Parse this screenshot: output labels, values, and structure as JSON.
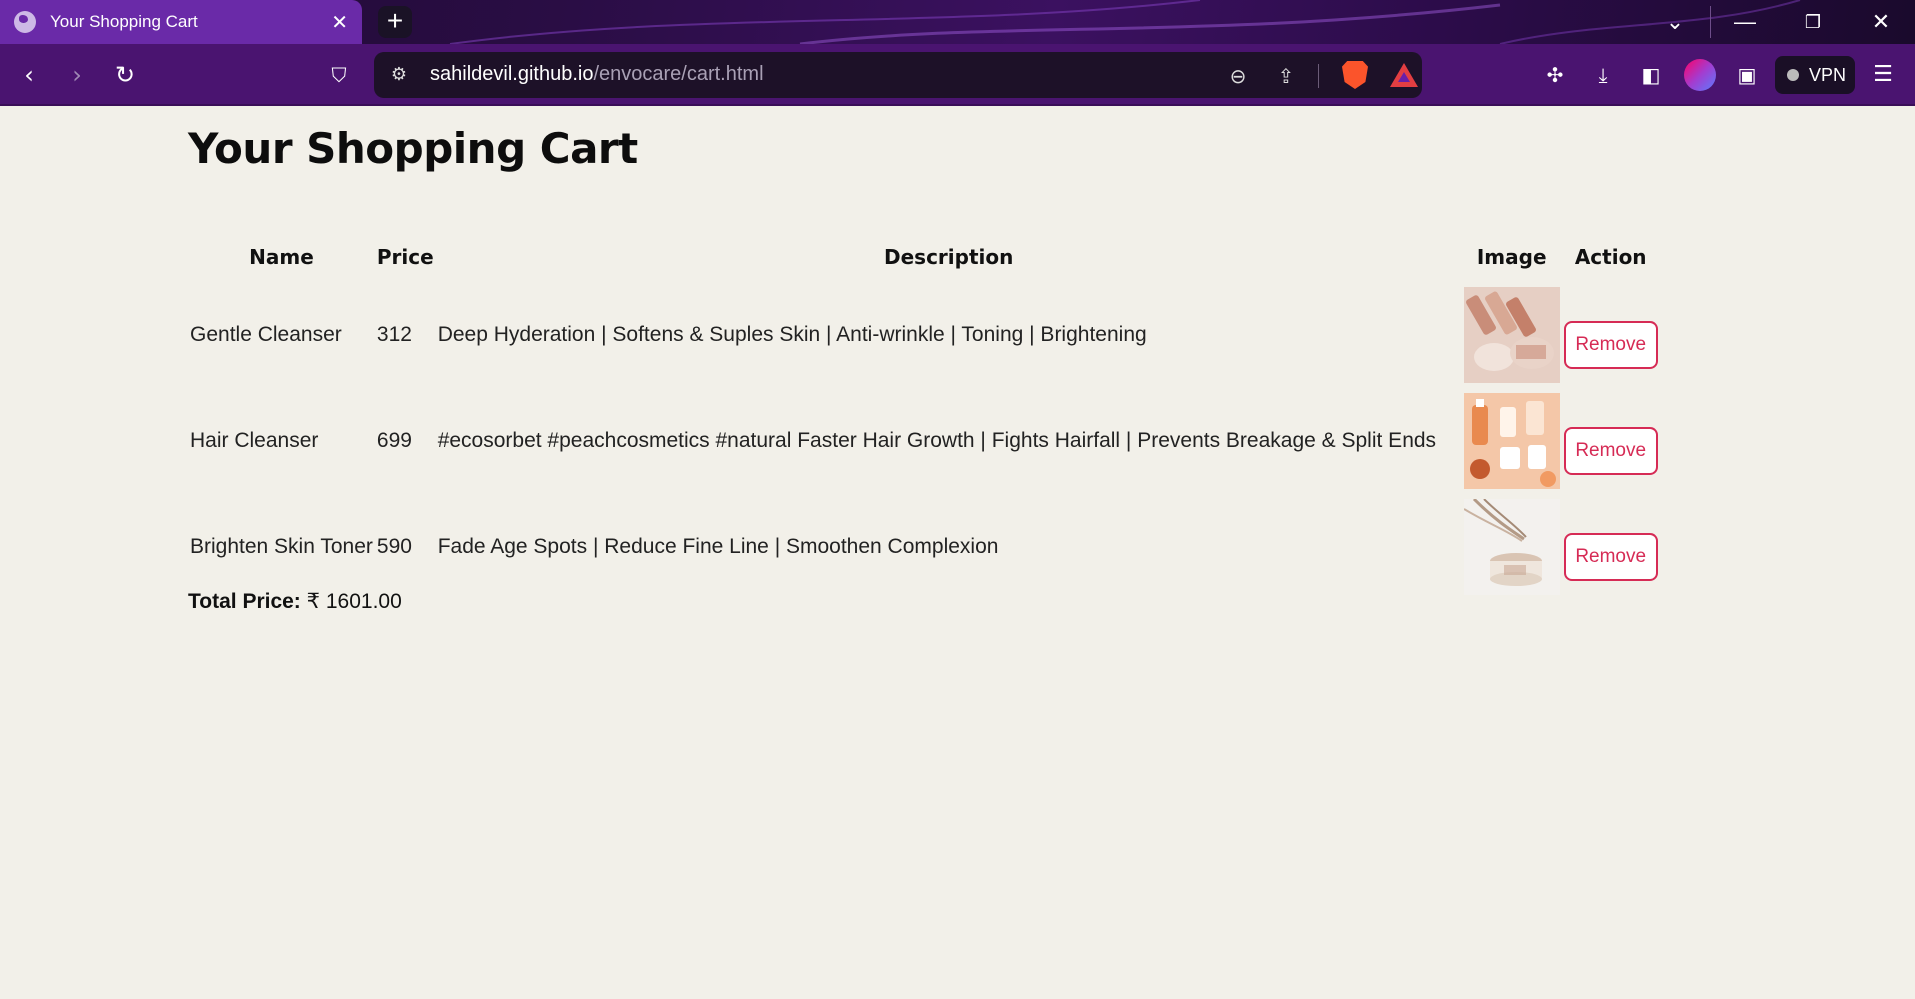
{
  "browser": {
    "tab_title": "Your Shopping Cart",
    "tab_close_icon": "close-icon",
    "new_tab_icon": "plus-icon",
    "url_host": "sahildevil.github.io",
    "url_path": "/envocare/cart.html",
    "vpn_label": "VPN",
    "accent_color": "#6a2aa8"
  },
  "page": {
    "heading": "Your Shopping Cart",
    "columns": {
      "name": "Name",
      "price": "Price",
      "description": "Description",
      "image": "Image",
      "action": "Action"
    },
    "items": [
      {
        "name": "Gentle Cleanser",
        "price": "312",
        "description": "Deep Hyderation | Softens & Suples Skin | Anti-wrinkle | Toning | Brightening",
        "action_label": "Remove"
      },
      {
        "name": "Hair Cleanser",
        "price": "699",
        "description": "#ecosorbet #peachcosmetics #natural Faster Hair Growth | Fights Hairfall | Prevents Breakage & Split Ends",
        "action_label": "Remove"
      },
      {
        "name": "Brighten Skin Toner",
        "price": "590",
        "description": "Fade Age Spots | Reduce Fine Line | Smoothen Complexion",
        "action_label": "Remove"
      }
    ],
    "total_label": "Total Price:",
    "total_value": "₹ 1601.00",
    "remove_color": "#d62b55"
  }
}
